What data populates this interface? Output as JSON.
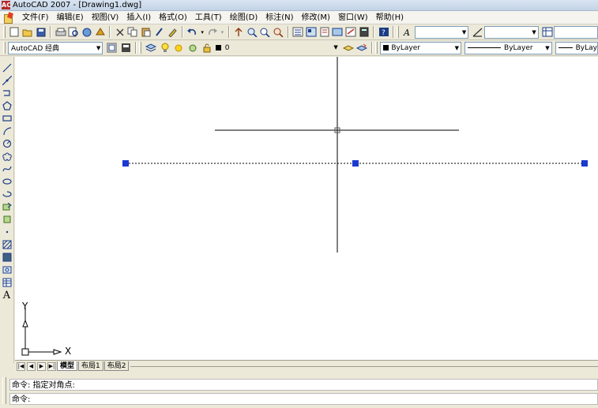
{
  "window": {
    "title": "AutoCAD 2007 - [Drawing1.dwg]",
    "app_icon": "AC"
  },
  "menubar": {
    "items": [
      "文件(F)",
      "编辑(E)",
      "视图(V)",
      "插入(I)",
      "格式(O)",
      "工具(T)",
      "绘图(D)",
      "标注(N)",
      "修改(M)",
      "窗口(W)",
      "帮助(H)"
    ]
  },
  "standard_toolbar": {
    "text_style_value": "",
    "dim_style_value": "",
    "table_style_value": ""
  },
  "properties_toolbar": {
    "workspace": "AutoCAD 经典",
    "layer": "0",
    "color": "ByLayer",
    "linetype": "ByLayer",
    "lineweight": "ByLay"
  },
  "draw_toolbar": {
    "text_tool_glyph": "A"
  },
  "ucs": {
    "x_label": "X",
    "y_label": "Y"
  },
  "layout_tabs": [
    "模型",
    "布局1",
    "布局2"
  ],
  "command": {
    "history": "命令: 指定对角点:",
    "prompt": "命令:"
  }
}
